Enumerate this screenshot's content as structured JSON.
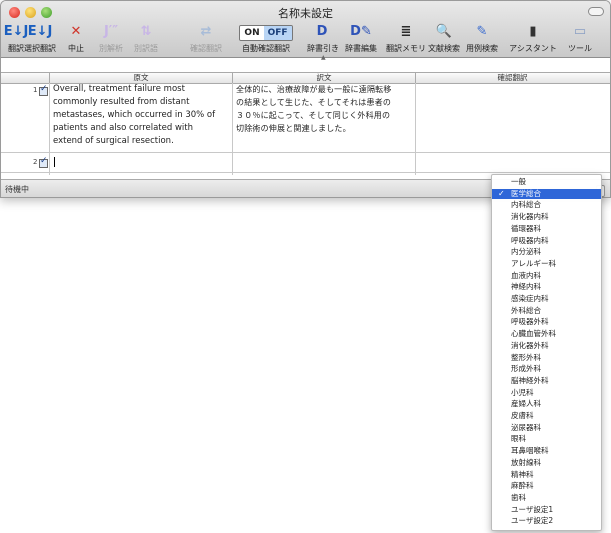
{
  "window": {
    "title": "名称未設定"
  },
  "toolbar": {
    "items": [
      {
        "label": "翻訳",
        "icon_name": "ej-translate-icon",
        "glyph": "E↓J",
        "color": "#1b5fbf",
        "enabled": true
      },
      {
        "label": "選択翻訳",
        "icon_name": "ej-selection-translate-icon",
        "glyph": "E↓J",
        "color": "#1b5fbf",
        "enabled": true
      },
      {
        "label": "中止",
        "icon_name": "stop-x-icon",
        "glyph": "✕",
        "color": "#d0352b",
        "enabled": true
      },
      {
        "label": "別解析",
        "icon_name": "alt-parse-icon",
        "glyph": "J′″",
        "color": "#c8b6e6",
        "enabled": false
      },
      {
        "label": "別訳語",
        "icon_name": "alt-word-icon",
        "glyph": "⇅",
        "color": "#c8b6e6",
        "enabled": false
      },
      {
        "label": "確認翻訳",
        "icon_name": "confirm-translate-icon",
        "glyph": "⇄",
        "color": "#a8bcd8",
        "enabled": false
      },
      {
        "label": "自動確認翻訳",
        "icon_name": "auto-confirm-toggle",
        "glyph": "",
        "color": "#000000",
        "enabled": true
      },
      {
        "label": "辞書引き",
        "icon_name": "dictionary-lookup-icon",
        "glyph": "D",
        "color": "#2e53b8",
        "enabled": true
      },
      {
        "label": "辞書編集",
        "icon_name": "dictionary-edit-icon",
        "glyph": "D✎",
        "color": "#2e53b8",
        "enabled": true
      },
      {
        "label": "翻訳メモリ",
        "icon_name": "translation-memory-icon",
        "glyph": "≣",
        "color": "#2a2a2a",
        "enabled": true
      },
      {
        "label": "文献検索",
        "icon_name": "magnifier-icon",
        "glyph": "🔍",
        "color": "#555555",
        "enabled": true
      },
      {
        "label": "用例検索",
        "icon_name": "example-search-icon",
        "glyph": "✎",
        "color": "#3b6ccf",
        "enabled": true
      },
      {
        "label": "アシスタント",
        "icon_name": "assistant-icon",
        "glyph": "▮",
        "color": "#333333",
        "enabled": true
      },
      {
        "label": "ツール",
        "icon_name": "tool-icon",
        "glyph": "▭",
        "color": "#8a9fc4",
        "enabled": true
      }
    ],
    "auto_confirm": {
      "on": "ON",
      "off": "OFF"
    }
  },
  "table": {
    "headers": [
      "原文",
      "訳文",
      "確認翻訳"
    ],
    "rows": [
      {
        "num": "1",
        "checked": true,
        "source": [
          "Overall, treatment failure most",
          "commonly resulted from distant",
          "metastases, which occurred in 30% of",
          "patients and also correlated with",
          "extend of surgical resection."
        ],
        "target": [
          "全体的に、治療故障が最も一般に遠隔転移",
          "の結果として生じた、そしてそれは患者の",
          "３０％に起こって、そして同じく外科用の",
          "切除術の伸展と関連しました。"
        ],
        "confirm": ""
      },
      {
        "num": "2",
        "checked": true,
        "source": [],
        "target": [],
        "confirm": ""
      }
    ]
  },
  "status": {
    "text": "待機中",
    "popup_glyph": "⇕"
  },
  "dropdown": {
    "selected_mark": "✓",
    "selected_index": 1,
    "options": [
      "一般",
      "医学総合",
      "内科総合",
      "消化器内科",
      "循環器科",
      "呼吸器内科",
      "内分泌科",
      "アレルギー科",
      "血液内科",
      "神経内科",
      "感染症内科",
      "外科総合",
      "呼吸器外科",
      "心臓血管外科",
      "消化器外科",
      "整形外科",
      "形成外科",
      "脳神経外科",
      "小児科",
      "産婦人科",
      "皮膚科",
      "泌尿器科",
      "眼科",
      "耳鼻咽喉科",
      "放射線科",
      "精神科",
      "麻酔科",
      "歯科",
      "ユーザ設定1",
      "ユーザ設定2"
    ]
  }
}
